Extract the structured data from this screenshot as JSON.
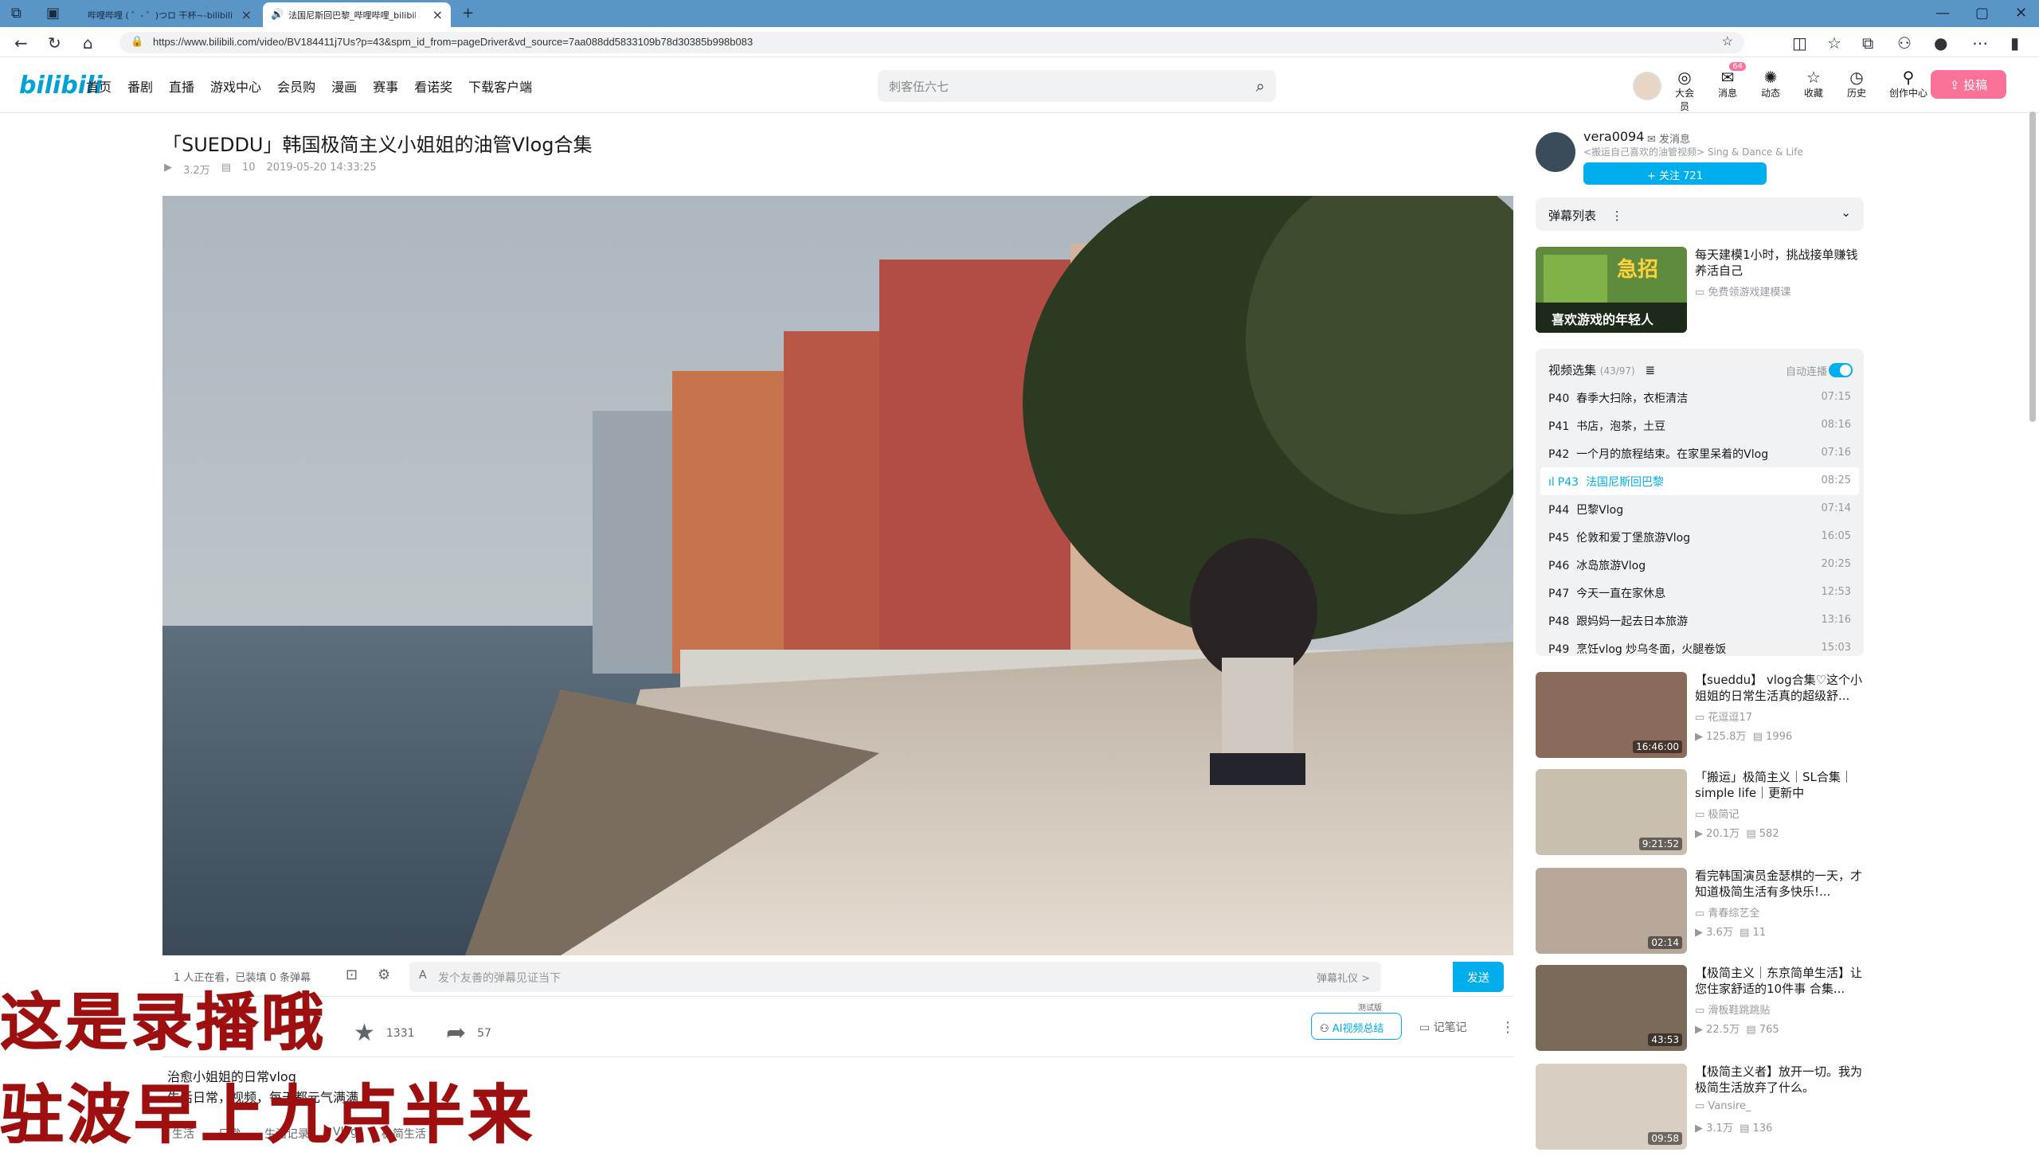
{
  "browser": {
    "tabs": [
      {
        "label": "哔哩哔哩 ( ゜- ゜)つロ 干杯~-bilibili"
      },
      {
        "label": "法国尼斯回巴黎_哔哩哔哩_bilibili"
      }
    ],
    "url": "https://www.bilibili.com/video/BV184411j7Us?p=43&spm_id_from=pageDriver&vd_source=7aa088dd5833109b78d30385b998b083"
  },
  "header": {
    "logo": "bilibili",
    "nav": [
      "首页",
      "番剧",
      "直播",
      "游戏中心",
      "会员购",
      "漫画",
      "赛事",
      "看诺奖",
      "下载客户端"
    ],
    "search_placeholder": "刺客伍六七",
    "icons": [
      {
        "label": "大会员",
        "icon": "vip-icon"
      },
      {
        "label": "消息",
        "icon": "message-icon",
        "badge": "64"
      },
      {
        "label": "动态",
        "icon": "dynamic-icon"
      },
      {
        "label": "收藏",
        "icon": "favorite-icon"
      },
      {
        "label": "历史",
        "icon": "history-icon"
      },
      {
        "label": "创作中心",
        "icon": "creator-icon"
      }
    ],
    "upload": "投稿"
  },
  "video": {
    "title": "「SUEDDU」韩国极简主义小姐姐的油管Vlog合集",
    "views": "3.2万",
    "danmaku": "10",
    "date": "2019-05-20 14:33:25",
    "watching": "1 人正在看，已装填 0 条弹幕",
    "danmaku_placeholder": "发个友善的弹幕见证当下",
    "danmaku_etiquette": "弹幕礼仪 >",
    "send": "发送",
    "favorites": "1331",
    "shares": "57",
    "ai_summary": "AI视频总结",
    "ai_badge": "测试版",
    "notes": "记笔记",
    "desc_line1": "治愈小姐姐的日常vlog",
    "desc_line2": "生活日常，视频，每天都元气满满",
    "tags": [
      "生活",
      "日常",
      "生活记录",
      "Vlog",
      "极简生活"
    ]
  },
  "overlay": {
    "line1": "这是录播哦",
    "line2": "驻波早上九点半来"
  },
  "uploader": {
    "name": "vera0094",
    "message": "发消息",
    "desc": "<搬运自己喜欢的油管视频> Sing & Dance & Life",
    "follow": "+ 关注 721"
  },
  "danmaku_list": {
    "label": "弹幕列表"
  },
  "ad": {
    "title": "每天建模1小时，挑战接单赚钱养活自己",
    "sub": "免费领游戏建模课",
    "thumb_text": "急招",
    "thumb_sub": "喜欢游戏的年轻人"
  },
  "episodes": {
    "header": "视频选集",
    "count": "(43/97)",
    "autoplay": "自动连播",
    "items": [
      {
        "p": "P40",
        "title": "春季大扫除，衣柜清洁",
        "time": "07:15"
      },
      {
        "p": "P41",
        "title": "书店，泡茶，土豆",
        "time": "08:16"
      },
      {
        "p": "P42",
        "title": "一个月的旅程结束。在家里呆着的Vlog",
        "time": "07:16"
      },
      {
        "p": "P43",
        "title": "法国尼斯回巴黎",
        "time": "08:25",
        "active": true
      },
      {
        "p": "P44",
        "title": "巴黎Vlog",
        "time": "07:14"
      },
      {
        "p": "P45",
        "title": "伦敦和爱丁堡旅游Vlog",
        "time": "16:05"
      },
      {
        "p": "P46",
        "title": "冰岛旅游Vlog",
        "time": "20:25"
      },
      {
        "p": "P47",
        "title": "今天一直在家休息",
        "time": "12:53"
      },
      {
        "p": "P48",
        "title": "跟妈妈一起去日本旅游",
        "time": "13:16"
      },
      {
        "p": "P49",
        "title": "烹饪vlog 炒乌冬面，火腿卷饭",
        "time": "15:03"
      }
    ]
  },
  "recommend": [
    {
      "title": "【sueddu】 vlog合集♡这个小姐姐的日常生活真的超级舒...",
      "author": "花逗逗17",
      "views": "125.8万",
      "dm": "1996",
      "dur": "16:46:00",
      "color": "#8a6a5a"
    },
    {
      "title": "「搬运」极简主义｜SL合集｜simple life｜更新中",
      "author": "极简记",
      "views": "20.1万",
      "dm": "582",
      "dur": "9:21:52",
      "color": "#c9bfae"
    },
    {
      "title": "看完韩国演员金瑟棋的一天，才知道极简生活有多快乐!...",
      "author": "青春综艺全",
      "views": "3.6万",
      "dm": "11",
      "dur": "02:14",
      "color": "#b8a89a"
    },
    {
      "title": "【极简主义｜东京简单生活】让您住家舒适的10件事 合集...",
      "author": "滑板鞋跳跳贴",
      "views": "22.5万",
      "dm": "765",
      "dur": "43:53",
      "color": "#7a6a5a"
    },
    {
      "title": "【极简主义者】放开一切。我为极简生活放弃了什么。",
      "author": "Vansire_",
      "views": "3.1万",
      "dm": "136",
      "dur": "09:58",
      "color": "#d8cfc2"
    }
  ]
}
